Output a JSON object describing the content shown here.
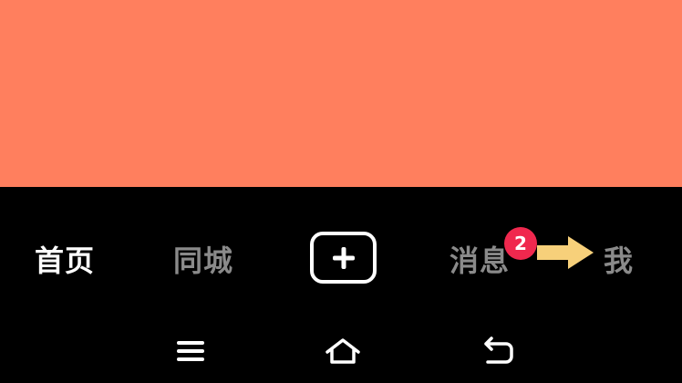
{
  "tabs": {
    "home": "首页",
    "city": "同城",
    "messages": "消息",
    "me": "我"
  },
  "messages_badge": "2",
  "colors": {
    "content_background": "#FF7F5E",
    "bar_background": "#000000",
    "active_tab": "#FFFFFF",
    "inactive_tab": "#8A8A8A",
    "badge": "#F0284E",
    "arrow_annotation": "#F7D07A"
  },
  "icons": {
    "create": "plus-icon",
    "annotation": "arrow-right-icon",
    "system_menu": "menu-icon",
    "system_home": "home-icon",
    "system_back": "back-icon"
  }
}
